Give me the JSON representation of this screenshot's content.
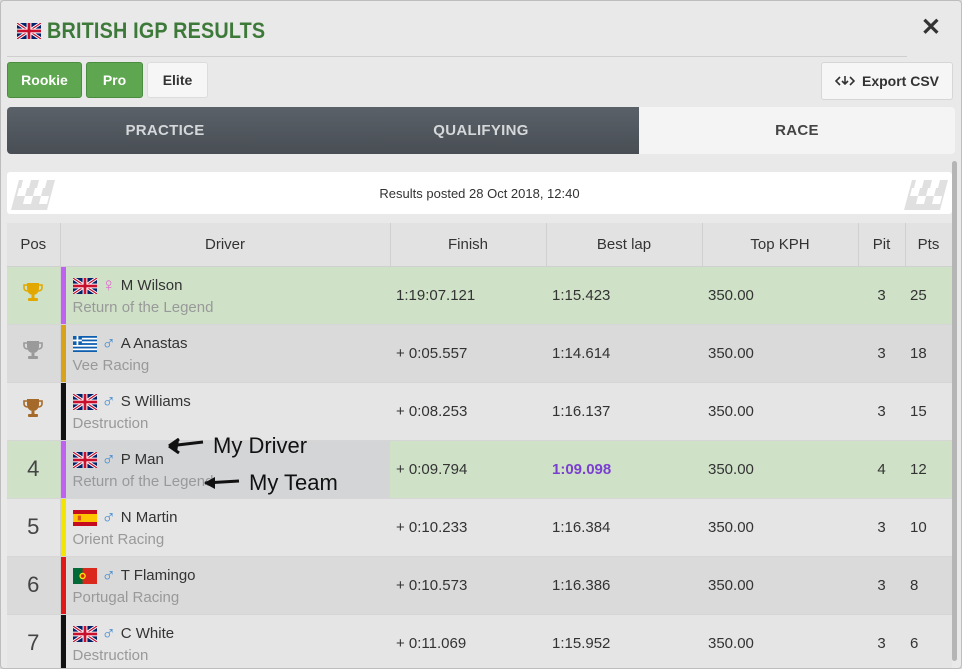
{
  "header": {
    "title": "BRITISH IGP RESULTS",
    "close_label": "✕"
  },
  "levels": [
    {
      "label": "Rookie",
      "active": true
    },
    {
      "label": "Pro",
      "active": true
    },
    {
      "label": "Elite",
      "active": false
    }
  ],
  "export": {
    "label": "Export CSV",
    "icon": "export-icon"
  },
  "tabs": [
    {
      "label": "PRACTICE",
      "active": false
    },
    {
      "label": "QUALIFYING",
      "active": false
    },
    {
      "label": "RACE",
      "active": true
    }
  ],
  "results_posted": "Results posted 28 Oct 2018, 12:40",
  "columns": [
    "Pos",
    "Driver",
    "Finish",
    "Best lap",
    "Top KPH",
    "Pit",
    "Pts"
  ],
  "rows": [
    {
      "pos": "",
      "trophy": "gold",
      "flag": "gb",
      "gender": "♀",
      "driver": "M Wilson",
      "team": "Return of the Legend",
      "team_color": "#c062f0",
      "finish": "1:19:07.121",
      "best_lap": "1:15.423",
      "top_kph": "350.00",
      "pit": "3",
      "pts": "25"
    },
    {
      "pos": "",
      "trophy": "silver",
      "flag": "gr",
      "gender": "♂",
      "driver": "A Anastas",
      "team": "Vee Racing",
      "team_color": "#d9a21b",
      "finish": "+ 0:05.557",
      "best_lap": "1:14.614",
      "top_kph": "350.00",
      "pit": "3",
      "pts": "18"
    },
    {
      "pos": "",
      "trophy": "bronze",
      "flag": "gb",
      "gender": "♂",
      "driver": "S Williams",
      "team": "Destruction",
      "team_color": "#111111",
      "finish": "+ 0:08.253",
      "best_lap": "1:16.137",
      "top_kph": "350.00",
      "pit": "3",
      "pts": "15"
    },
    {
      "pos": "4",
      "trophy": "",
      "flag": "gb",
      "gender": "♂",
      "driver": "P Man",
      "team": "Return of the Legend",
      "team_color": "#c062f0",
      "finish": "+ 0:09.794",
      "best_lap": "1:09.098",
      "top_kph": "350.00",
      "pit": "4",
      "pts": "12"
    },
    {
      "pos": "5",
      "trophy": "",
      "flag": "es",
      "gender": "♂",
      "driver": "N Martin",
      "team": "Orient Racing",
      "team_color": "#f2e600",
      "finish": "+ 0:10.233",
      "best_lap": "1:16.384",
      "top_kph": "350.00",
      "pit": "3",
      "pts": "10"
    },
    {
      "pos": "6",
      "trophy": "",
      "flag": "pt",
      "gender": "♂",
      "driver": "T Flamingo",
      "team": "Portugal Racing",
      "team_color": "#e01818",
      "finish": "+ 0:10.573",
      "best_lap": "1:16.386",
      "top_kph": "350.00",
      "pit": "3",
      "pts": "8"
    },
    {
      "pos": "7",
      "trophy": "",
      "flag": "gb",
      "gender": "♂",
      "driver": "C White",
      "team": "Destruction",
      "team_color": "#111111",
      "finish": "+ 0:11.069",
      "best_lap": "1:15.952",
      "top_kph": "350.00",
      "pit": "3",
      "pts": "6"
    }
  ],
  "annotations": {
    "driver": "My Driver",
    "team": "My Team"
  },
  "colors": {
    "accent_green": "#5ea64f",
    "title_green": "#3d7a3a",
    "best_lap_purple": "#7b3fd0",
    "highlight_row": "#cfe2c8"
  }
}
